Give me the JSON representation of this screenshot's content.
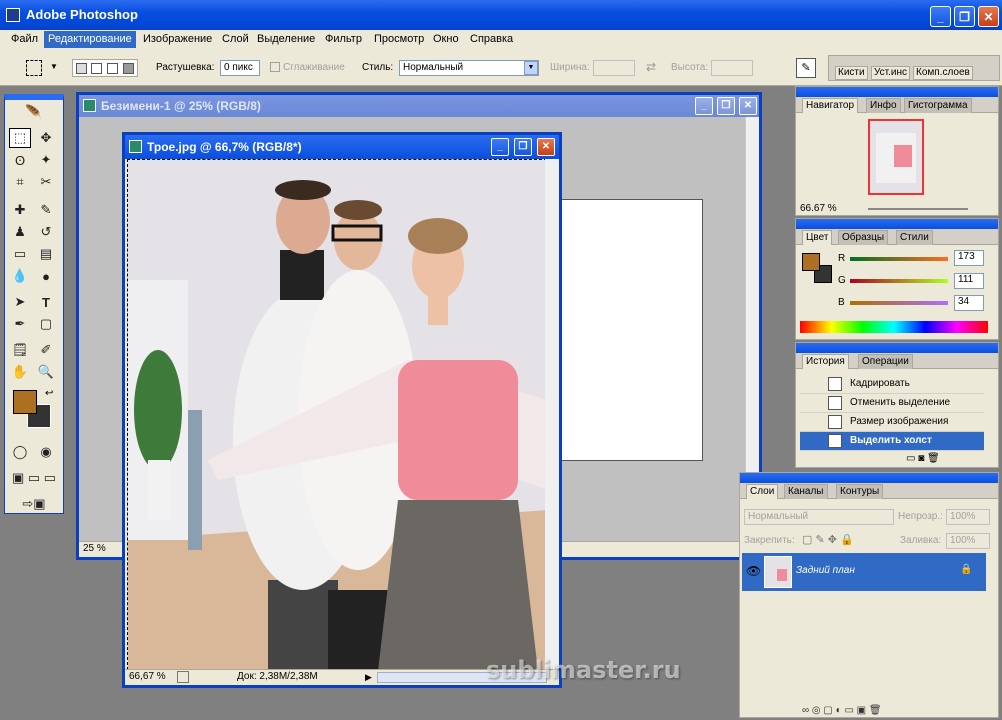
{
  "app": {
    "title": "Adobe Photoshop"
  },
  "menu": [
    "Файл",
    "Редактирование",
    "Изображение",
    "Слой",
    "Выделение",
    "Фильтр",
    "Просмотр",
    "Окно",
    "Справка"
  ],
  "options": {
    "feather_label": "Растушевка:",
    "feather_value": "0 пикс",
    "antialias_label": "Сглаживание",
    "style_label": "Стиль:",
    "style_value": "Нормальный",
    "width_label": "Ширина:",
    "height_label": "Высота:"
  },
  "tabwell": [
    "Кисти",
    "Уст.инс",
    "Комп.слоев"
  ],
  "doc_back": {
    "title": "Безимени-1 @ 25% (RGB/8)",
    "zoom": "25 %"
  },
  "doc_front": {
    "title": "Трое.jpg @ 66,7% (RGB/8*)",
    "zoom": "66,67 %",
    "doc_size": "Док: 2,38M/2,38M"
  },
  "navigator": {
    "tabs": [
      "Навигатор",
      "Инфо",
      "Гистограмма"
    ],
    "zoom": "66.67 %"
  },
  "color": {
    "tabs": [
      "Цвет",
      "Образцы",
      "Стили"
    ],
    "r_label": "R",
    "g_label": "G",
    "b_label": "B",
    "r": "173",
    "g": "111",
    "b": "34",
    "fg": "#ad6f22"
  },
  "history": {
    "tabs": [
      "История",
      "Операции"
    ],
    "items": [
      "Кадрировать",
      "Отменить выделение",
      "Размер изображения",
      "Выделить холст"
    ]
  },
  "layers": {
    "tabs": [
      "Слои",
      "Каналы",
      "Контуры"
    ],
    "blend": "Нормальный",
    "opacity_label": "Непрозр.:",
    "opacity": "100%",
    "lock_label": "Закрепить:",
    "fill_label": "Заливка:",
    "fill": "100%",
    "layer_name": "Задний план"
  },
  "watermark": "sublimaster.ru"
}
